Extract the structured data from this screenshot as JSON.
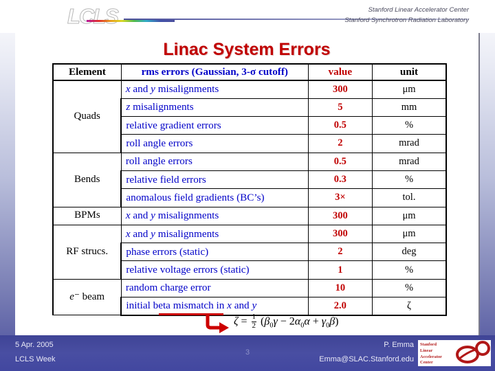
{
  "header": {
    "logo_text": "LCLS",
    "org_line1": "Stanford Linear Accelerator Center",
    "org_line2": "Stanford Synchrotron Radiation Laboratory"
  },
  "title": "Linac System Errors",
  "table": {
    "columns": [
      "Element",
      "rms errors (Gaussian, 3-σ cutoff)",
      "value",
      "unit"
    ],
    "column_colors": {
      "element": "#000000",
      "description": "#0000c8",
      "value": "#c00000",
      "unit": "#000000"
    },
    "groups": [
      {
        "element": "Quads",
        "rows": [
          {
            "desc": "x and y misalignments",
            "value": "300",
            "unit": "μm"
          },
          {
            "desc": "z misalignments",
            "value": "5",
            "unit": "mm"
          },
          {
            "desc": "relative gradient errors",
            "value": "0.5",
            "unit": "%"
          },
          {
            "desc": "roll angle errors",
            "value": "2",
            "unit": "mrad"
          }
        ]
      },
      {
        "element": "Bends",
        "rows": [
          {
            "desc": "roll angle errors",
            "value": "0.5",
            "unit": "mrad"
          },
          {
            "desc": "relative field errors",
            "value": "0.3",
            "unit": "%"
          },
          {
            "desc": "anomalous field gradients (BC’s)",
            "value": "3×",
            "unit": "tol."
          }
        ]
      },
      {
        "element": "BPMs",
        "rows": [
          {
            "desc": "x and y misalignments",
            "value": "300",
            "unit": "μm"
          }
        ]
      },
      {
        "element": "RF strucs.",
        "rows": [
          {
            "desc": "x and y misalignments",
            "value": "300",
            "unit": "μm"
          },
          {
            "desc": "phase errors (static)",
            "value": "2",
            "unit": "deg"
          },
          {
            "desc": "relative voltage errors (static)",
            "value": "1",
            "unit": "%"
          }
        ]
      },
      {
        "element": "e⁻ beam",
        "rows": [
          {
            "desc": "random charge error",
            "value": "10",
            "unit": "%"
          },
          {
            "desc": "initial beta mismatch in x and y",
            "value": "2.0",
            "unit": "ζ"
          }
        ]
      }
    ]
  },
  "annotation": {
    "underlined_phrase": "beta mismatch",
    "formula_plain": "ζ = 1/2 (β₀γ − 2α₀α + γ₀β)",
    "arrow_color": "#cc0000"
  },
  "footer": {
    "date": "5 Apr. 2005",
    "event": "LCLS Week",
    "page_number": "3",
    "author": "P. Emma",
    "email": "Emma@SLAC.Stanford.edu",
    "badge_lines": [
      "Stanford",
      "Linear",
      "Accelerator",
      "Center"
    ],
    "background_color": "#454aa0"
  }
}
